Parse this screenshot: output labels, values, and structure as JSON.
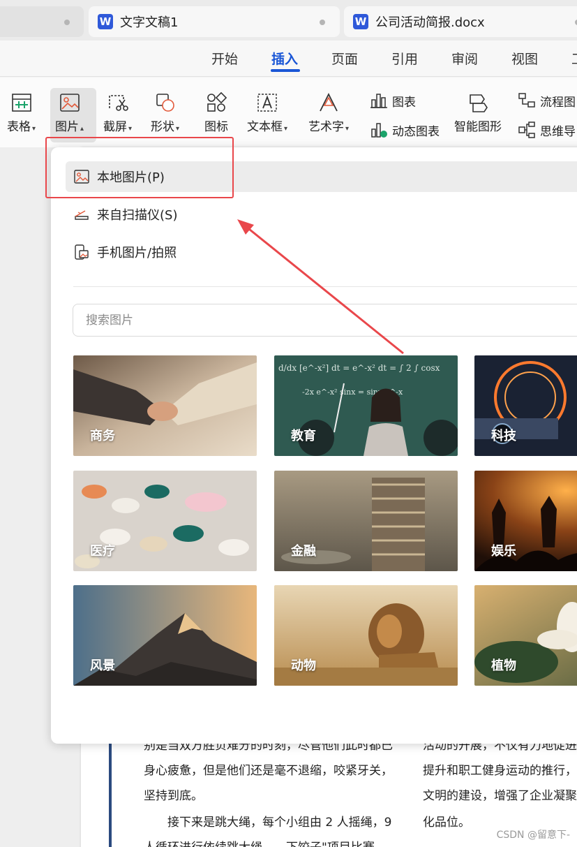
{
  "tabs": [
    {
      "title": ""
    },
    {
      "title": "文字文稿1",
      "logo": "W"
    },
    {
      "title": "公司活动简报.docx",
      "logo": "W"
    }
  ],
  "menu_tabs": [
    "开始",
    "插入",
    "页面",
    "引用",
    "审阅",
    "视图",
    "工"
  ],
  "active_menu": "插入",
  "ribbon": {
    "table": "表格",
    "picture": "图片",
    "screenshot": "截屏",
    "shape": "形状",
    "icon": "图标",
    "textbox": "文本框",
    "wordart": "艺术字",
    "chart": "图表",
    "dynamic_chart": "动态图表",
    "smart_graphic": "智能图形",
    "flowchart": "流程图",
    "mindmap": "思维导"
  },
  "picture_menu": {
    "local": "本地图片(P)",
    "scanner": "来自扫描仪(S)",
    "phone": "手机图片/拍照",
    "search_placeholder": "搜索图片",
    "categories": [
      "商务",
      "教育",
      "科技",
      "医疗",
      "金融",
      "娱乐",
      "风景",
      "动物",
      "植物"
    ]
  },
  "document": {
    "lines": [
      "别是当双方胜负难分的时刻，尽管他们此时都已",
      "身心疲惫，但是他们还是毫不退缩，咬紧牙关，",
      "坚持到底。",
      "接下来是跳大绳，每个小组由 2 人摇绳，9",
      "人循环进行依续跳大绳……下饺子\"项目比赛"
    ],
    "right_lines": [
      "活动的开展，不仅有力地促进",
      "提升和职工健身运动的推行，",
      "文明的建设，增强了企业凝聚",
      "化品位。"
    ]
  },
  "watermark": "CSDN @留意下-",
  "colors": {
    "accent": "#1a56d6",
    "annotation": "#e9474b",
    "word_logo": "#2f59d9"
  }
}
